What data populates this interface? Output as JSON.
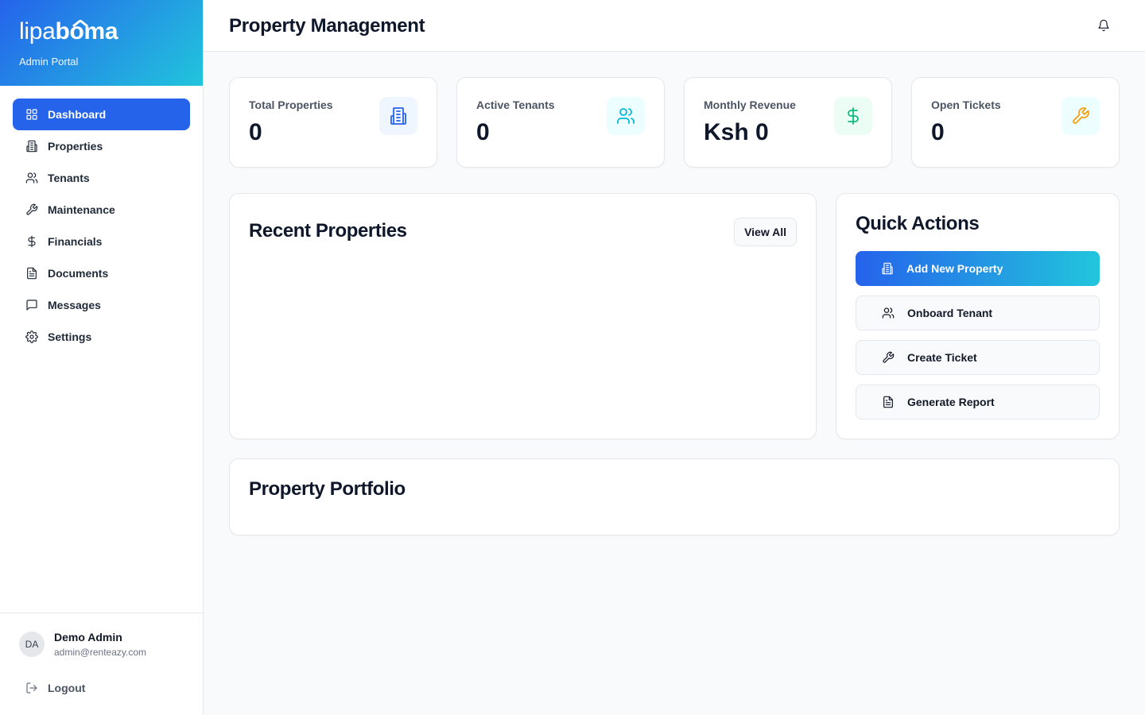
{
  "brand": {
    "logo_part1": "lipa",
    "logo_part2": "boma",
    "subtitle": "Admin Portal",
    "gradient_start": "#2563eb",
    "gradient_end": "#22c5dc"
  },
  "sidebar": {
    "items": [
      {
        "label": "Dashboard",
        "icon": "grid-icon",
        "active": true
      },
      {
        "label": "Properties",
        "icon": "building-icon"
      },
      {
        "label": "Tenants",
        "icon": "users-icon"
      },
      {
        "label": "Maintenance",
        "icon": "wrench-icon"
      },
      {
        "label": "Financials",
        "icon": "dollar-icon"
      },
      {
        "label": "Documents",
        "icon": "document-icon"
      },
      {
        "label": "Messages",
        "icon": "message-icon"
      },
      {
        "label": "Settings",
        "icon": "gear-icon"
      }
    ]
  },
  "user": {
    "initials": "DA",
    "name": "Demo Admin",
    "email": "admin@renteazy.com",
    "logout_label": "Logout"
  },
  "header": {
    "title": "Property Management",
    "notification_icon": "bell-icon"
  },
  "stats": [
    {
      "label": "Total Properties",
      "value": "0",
      "icon": "building-icon",
      "icon_color": "#2563eb"
    },
    {
      "label": "Active Tenants",
      "value": "0",
      "icon": "users-icon",
      "icon_color": "#06b6d4"
    },
    {
      "label": "Monthly Revenue",
      "value": "Ksh 0",
      "icon": "dollar-icon",
      "icon_color": "#10b981"
    },
    {
      "label": "Open Tickets",
      "value": "0",
      "icon": "wrench-icon",
      "icon_color": "#f59e0b"
    }
  ],
  "recent": {
    "title": "Recent Properties",
    "view_all": "View All"
  },
  "quick_actions": {
    "title": "Quick Actions",
    "buttons": [
      {
        "label": "Add New Property",
        "icon": "building-icon",
        "primary": true
      },
      {
        "label": "Onboard Tenant",
        "icon": "users-icon"
      },
      {
        "label": "Create Ticket",
        "icon": "wrench-icon"
      },
      {
        "label": "Generate Report",
        "icon": "document-icon"
      }
    ]
  },
  "portfolio": {
    "title": "Property Portfolio"
  }
}
